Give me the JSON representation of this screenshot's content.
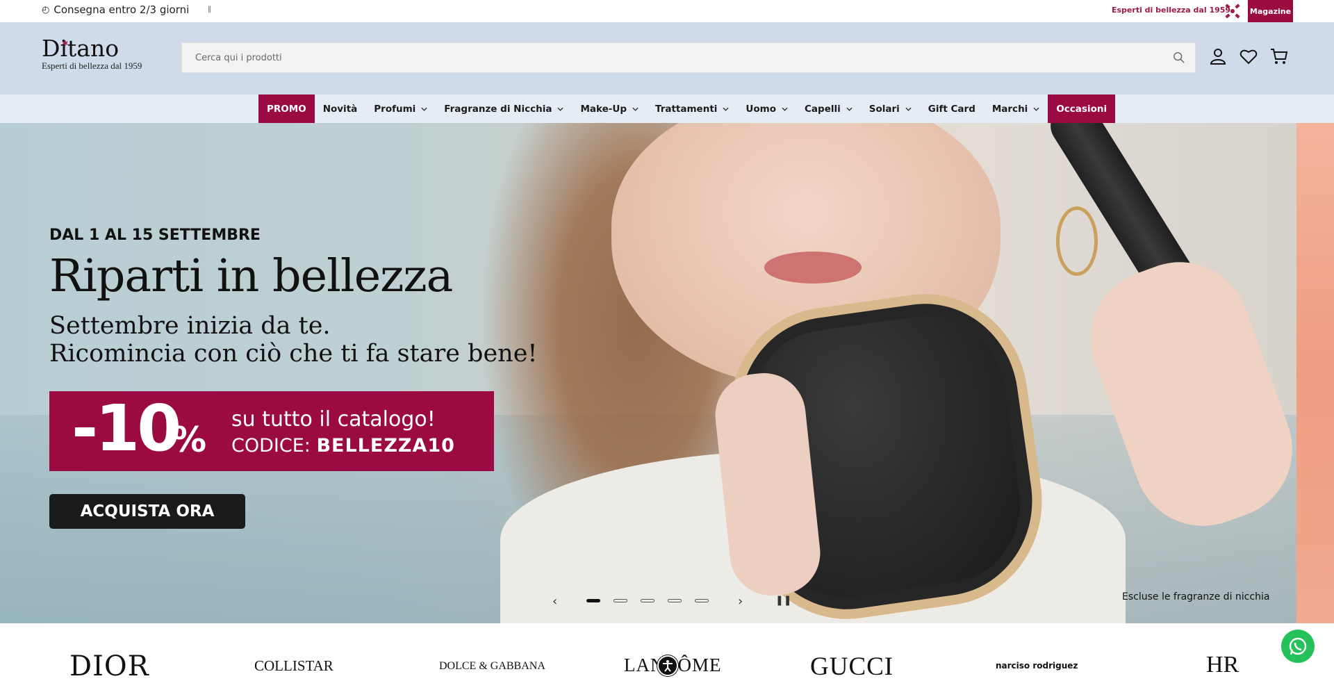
{
  "topbar": {
    "delivery_icon": "box-icon",
    "delivery_text": "Consegna entro 2/3 giorni",
    "experts_text": "Esperti di bellezza dal 1959",
    "magazine_label": "Magazine"
  },
  "header": {
    "brand_name": "Ditano",
    "brand_tagline": "Esperti di bellezza dal 1959",
    "search_placeholder": "Cerca qui i prodotti",
    "icons": [
      "search-icon",
      "account-icon",
      "wishlist-heart-icon",
      "cart-icon"
    ]
  },
  "nav": {
    "items": [
      {
        "label": "PROMO",
        "highlight": true,
        "dropdown": false
      },
      {
        "label": "Novità",
        "highlight": false,
        "dropdown": false
      },
      {
        "label": "Profumi",
        "highlight": false,
        "dropdown": true
      },
      {
        "label": "Fragranze di Nicchia",
        "highlight": false,
        "dropdown": true
      },
      {
        "label": "Make-Up",
        "highlight": false,
        "dropdown": true
      },
      {
        "label": "Trattamenti",
        "highlight": false,
        "dropdown": true
      },
      {
        "label": "Uomo",
        "highlight": false,
        "dropdown": true
      },
      {
        "label": "Capelli",
        "highlight": false,
        "dropdown": true
      },
      {
        "label": "Solari",
        "highlight": false,
        "dropdown": true
      },
      {
        "label": "Gift Card",
        "highlight": false,
        "dropdown": false
      },
      {
        "label": "Marchi",
        "highlight": false,
        "dropdown": true
      },
      {
        "label": "Occasioni",
        "highlight": true,
        "dropdown": false
      }
    ]
  },
  "hero": {
    "eyebrow": "DAL 1 AL 15 SETTEMBRE",
    "title": "Riparti in bellezza",
    "subtitle_line1": "Settembre inizia da te.",
    "subtitle_line2": "Ricomincia con ciò che ti fa stare bene!",
    "promo_discount": "-10",
    "promo_percent": "%",
    "promo_line1": "su tutto il catalogo!",
    "promo_code_label": "CODICE: ",
    "promo_code": "BELLEZZA10",
    "cta_label": "ACQUISTA ORA",
    "note": "Escluse le fragranze di nicchia",
    "slides_total": 5,
    "active_slide": 1
  },
  "brands": [
    "DIOR",
    "COLLISTAR",
    "DOLCE & GABBANA",
    "LANCÔME",
    "GUCCI",
    "narciso rodriguez",
    "HR"
  ],
  "colors": {
    "accent": "#9b0b42",
    "header_bg": "#cfdbe8",
    "nav_bg": "#e6ecf4",
    "whatsapp": "#25c15a"
  }
}
